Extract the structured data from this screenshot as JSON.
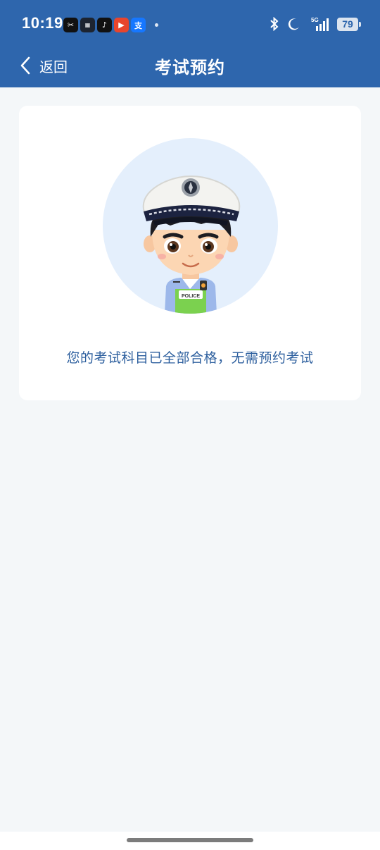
{
  "status_bar": {
    "time": "10:19",
    "battery": "79",
    "network": "5G",
    "app_icons": [
      "capcut-icon",
      "news-icon",
      "tiktok-icon",
      "video-app-icon",
      "alipay-icon"
    ]
  },
  "nav": {
    "back_label": "返回",
    "title": "考试预约"
  },
  "card": {
    "message": "您的考试科目已全部合格，无需预约考试",
    "badge_text": "POLICE"
  },
  "colors": {
    "header": "#2e66ad",
    "background": "#f4f7f9",
    "message": "#2d5f9e",
    "avatar_circle": "#e4effc"
  }
}
